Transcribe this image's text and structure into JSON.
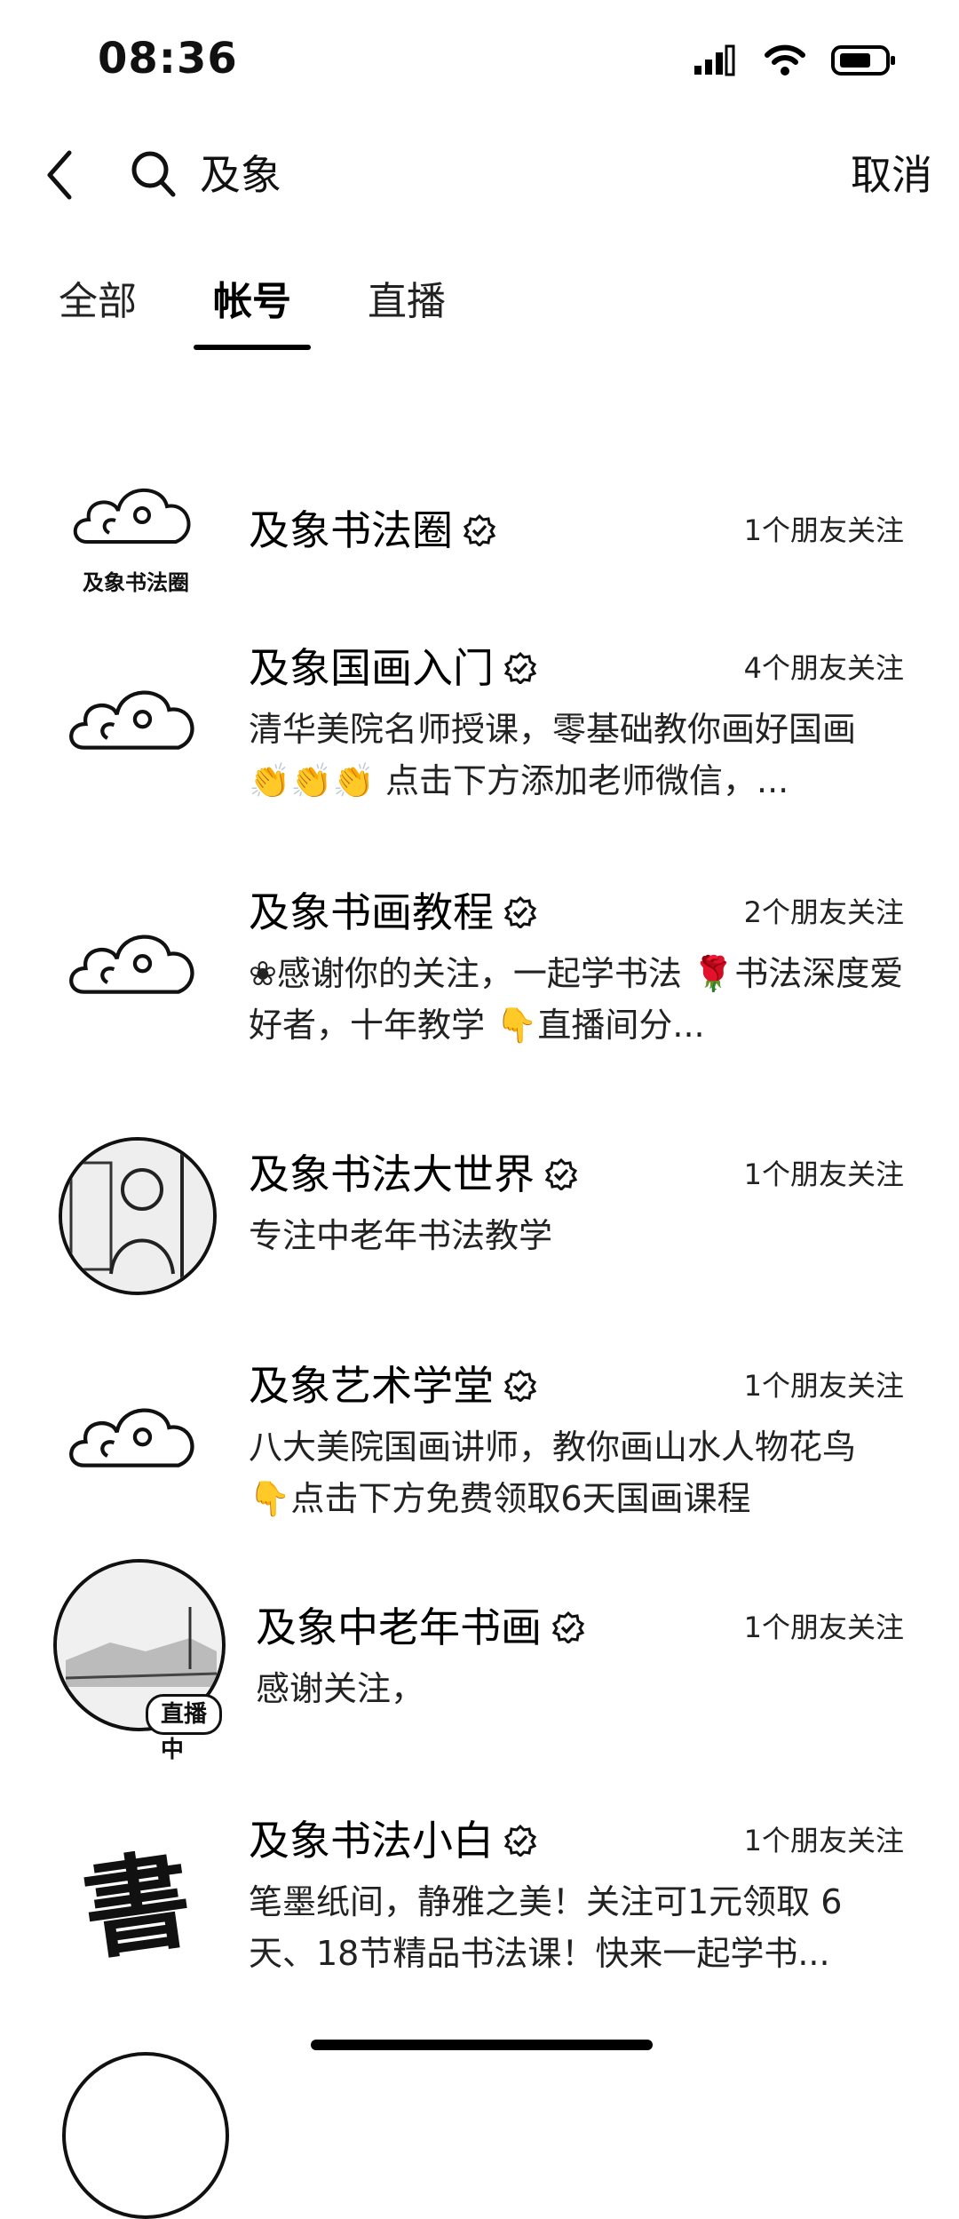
{
  "status": {
    "time": "08:36"
  },
  "search": {
    "query": "及象",
    "cancel_label": "取消"
  },
  "tabs": [
    {
      "label": "全部"
    },
    {
      "label": "帐号"
    },
    {
      "label": "直播"
    }
  ],
  "accounts": [
    {
      "name": "及象书法圈",
      "friends": "1个朋友关注",
      "description": "",
      "logo_text": "及象书法圈"
    },
    {
      "name": "及象国画入门",
      "friends": "4个朋友关注",
      "description": "清华美院名师授课，零基础教你画好国画 👏👏👏 点击下方添加老师微信，..."
    },
    {
      "name": "及象书画教程",
      "friends": "2个朋友关注",
      "description": "❀感谢你的关注，一起学书法 🌹书法深度爱好者，十年教学 👇直播间分..."
    },
    {
      "name": "及象书法大世界",
      "friends": "1个朋友关注",
      "description": "专注中老年书法教学"
    },
    {
      "name": "及象艺术学堂",
      "friends": "1个朋友关注",
      "description": "八大美院国画讲师，教你画山水人物花鸟 👇点击下方免费领取6天国画课程"
    },
    {
      "name": "及象中老年书画",
      "friends": "1个朋友关注",
      "description": "感谢关注，",
      "live_badge": "直播中"
    },
    {
      "name": "及象书法小白",
      "friends": "1个朋友关注",
      "description": "笔墨纸间，静雅之美！关注可1元领取 6天、18节精品书法课！快来一起学书...",
      "logo_glyph": "書"
    }
  ]
}
